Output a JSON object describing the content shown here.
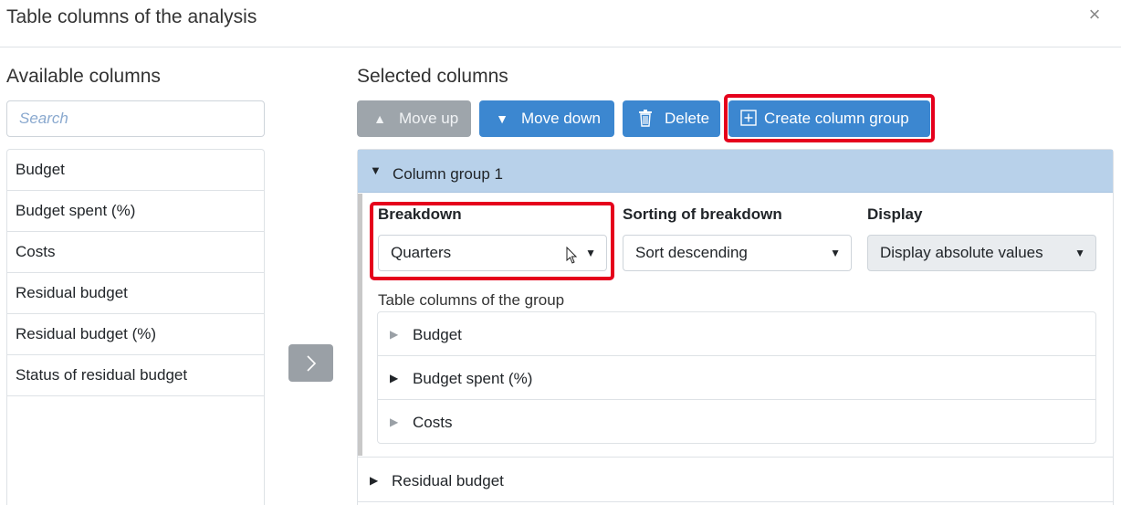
{
  "dialog": {
    "title": "Table columns of the analysis",
    "close_glyph": "×"
  },
  "available": {
    "heading": "Available columns",
    "search_placeholder": "Search",
    "items": [
      "Budget",
      "Budget spent (%)",
      "Costs",
      "Residual budget",
      "Residual budget (%)",
      "Status of residual budget"
    ]
  },
  "selected": {
    "heading": "Selected columns",
    "toolbar": {
      "move_up": "Move up",
      "move_down": "Move down",
      "delete": "Delete",
      "create_group": "Create column group"
    },
    "group": {
      "title": "Column group 1",
      "breakdown_label": "Breakdown",
      "breakdown_value": "Quarters",
      "sorting_label": "Sorting of breakdown",
      "sorting_value": "Sort descending",
      "display_label": "Display",
      "display_value": "Display absolute values",
      "group_columns_label": "Table columns of the group",
      "columns": [
        "Budget",
        "Budget spent (%)",
        "Costs"
      ]
    },
    "other_rows": [
      "Residual budget"
    ]
  },
  "icons": {
    "close": "close-icon",
    "move_up": "triangle-up-icon",
    "move_down": "triangle-down-icon",
    "delete": "trash-icon",
    "create_group": "plus-square-icon",
    "transfer": "chevron-right-icon"
  },
  "colors": {
    "primary": "#3c87d0",
    "disabled": "#9ea5ab",
    "group_header": "#b8d1ea",
    "highlight": "#e5001c"
  }
}
